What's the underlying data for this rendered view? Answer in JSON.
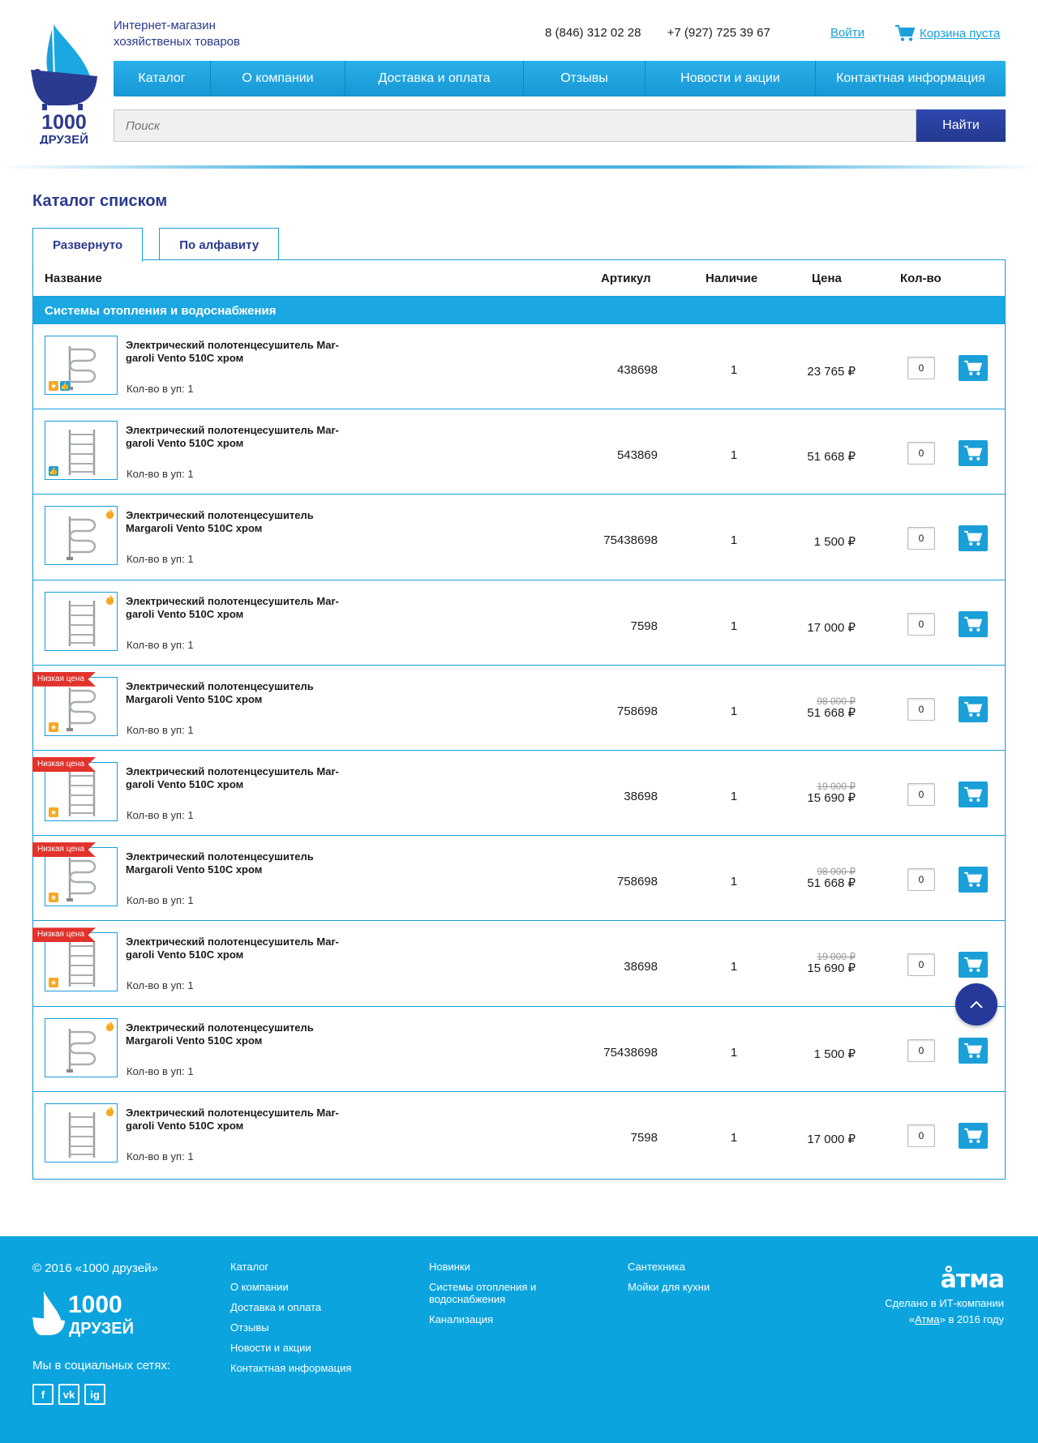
{
  "header": {
    "tagline_1": "Интернет-магазин",
    "tagline_2": "хозяйственых товаров",
    "logo_number": "1000",
    "logo_word": "ДРУЗЕЙ",
    "phone_1": "8 (846) 312 02 28",
    "phone_2": "+7 (927) 725 39 67",
    "login": "Войти",
    "cart": "Корзина пуста"
  },
  "nav": {
    "items": [
      {
        "label": "Каталог"
      },
      {
        "label": "О компании"
      },
      {
        "label": "Доставка и оплата"
      },
      {
        "label": "Отзывы"
      },
      {
        "label": "Новости и акции"
      },
      {
        "label": "Контактная информация"
      }
    ]
  },
  "search": {
    "placeholder": "Поиск",
    "button": "Найти"
  },
  "main": {
    "title": "Каталог списком",
    "tabs": [
      {
        "label": "Развернуто",
        "active": true
      },
      {
        "label": "По алфавиту",
        "active": false
      }
    ],
    "columns": {
      "name": "Название",
      "sku": "Артикул",
      "stock": "Наличие",
      "price": "Цена",
      "qty": "Кол-во"
    },
    "category": "Системы отопления и водоснабжения",
    "sale_label": "Низкая цена",
    "products": [
      {
        "name": "Электрический полотенцесушитель Mar-garoli Vento 510C хром",
        "pack": "Кол-во в уп: 1",
        "sku": "438698",
        "stock": "1",
        "price": "23 765 ₽",
        "old_price": "",
        "qty": "0",
        "badges": [
          "star",
          "like"
        ],
        "fire": false,
        "sale": false,
        "shape": "s-curve"
      },
      {
        "name": "Электрический полотенцесушитель Mar-garoli Vento 510C хром",
        "pack": "Кол-во в уп: 1",
        "sku": "543869",
        "stock": "1",
        "price": "51 668 ₽",
        "old_price": "",
        "qty": "0",
        "badges": [
          "like"
        ],
        "fire": false,
        "sale": false,
        "shape": "ladder"
      },
      {
        "name": "Электрический полотенцесушитель Margaroli Vento 510C хром",
        "pack": "Кол-во в уп: 1",
        "sku": "75438698",
        "stock": "1",
        "price": "1 500 ₽",
        "old_price": "",
        "qty": "0",
        "badges": [],
        "fire": true,
        "sale": false,
        "shape": "s-curve"
      },
      {
        "name": "Электрический полотенцесушитель Mar-garoli Vento 510C хром",
        "pack": "Кол-во в уп: 1",
        "sku": "7598",
        "stock": "1",
        "price": "17 000 ₽",
        "old_price": "",
        "qty": "0",
        "badges": [],
        "fire": true,
        "sale": false,
        "shape": "ladder"
      },
      {
        "name": "Электрический полотенцесушитель Margaroli Vento 510C хром",
        "pack": "Кол-во в уп: 1",
        "sku": "758698",
        "stock": "1",
        "price": "51 668 ₽",
        "old_price": "98 000 ₽",
        "qty": "0",
        "badges": [
          "star"
        ],
        "fire": false,
        "sale": true,
        "shape": "s-curve"
      },
      {
        "name": "Электрический полотенцесушитель Mar-garoli Vento 510C хром",
        "pack": "Кол-во в уп: 1",
        "sku": "38698",
        "stock": "1",
        "price": "15 690 ₽",
        "old_price": "19 000 ₽",
        "qty": "0",
        "badges": [
          "star"
        ],
        "fire": false,
        "sale": true,
        "shape": "ladder"
      },
      {
        "name": "Электрический полотенцесушитель Margaroli Vento 510C хром",
        "pack": "Кол-во в уп: 1",
        "sku": "758698",
        "stock": "1",
        "price": "51 668 ₽",
        "old_price": "98 000 ₽",
        "qty": "0",
        "badges": [
          "star"
        ],
        "fire": false,
        "sale": true,
        "shape": "s-curve"
      },
      {
        "name": "Электрический полотенцесушитель Mar-garoli Vento 510C хром",
        "pack": "Кол-во в уп: 1",
        "sku": "38698",
        "stock": "1",
        "price": "15 690 ₽",
        "old_price": "19 000 ₽",
        "qty": "0",
        "badges": [
          "star"
        ],
        "fire": false,
        "sale": true,
        "shape": "ladder"
      },
      {
        "name": "Электрический полотенцесушитель Margaroli Vento 510C хром",
        "pack": "Кол-во в уп: 1",
        "sku": "75438698",
        "stock": "1",
        "price": "1 500 ₽",
        "old_price": "",
        "qty": "0",
        "badges": [],
        "fire": true,
        "sale": false,
        "shape": "s-curve"
      },
      {
        "name": "Электрический полотенцесушитель Mar-garoli Vento 510C хром",
        "pack": "Кол-во в уп: 1",
        "sku": "7598",
        "stock": "1",
        "price": "17 000 ₽",
        "old_price": "",
        "qty": "0",
        "badges": [],
        "fire": true,
        "sale": false,
        "shape": "ladder"
      }
    ]
  },
  "footer": {
    "copyright": "© 2016 «1000 друзей»",
    "logo_number": "1000",
    "logo_word": "ДРУЗЕЙ",
    "social_title": "Мы в социальных сетях:",
    "socials": [
      "f",
      "vk",
      "ig"
    ],
    "col1": [
      "Каталог",
      "О компании",
      "Доставка и оплата",
      "Отзывы",
      "Новости и акции",
      "Контактная информация"
    ],
    "col2": [
      "Новинки",
      "Системы отопления и водоснабжения",
      "Канализация"
    ],
    "col3": [
      "Сантехника",
      "Мойки для кухни"
    ],
    "atma_logo": "åтма",
    "made_by_1": "Сделано в ИТ-компании",
    "made_by_2a": "«",
    "made_by_link": "Атма",
    "made_by_2b": "» в 2016 году"
  },
  "colors": {
    "accent": "#1a9fd9",
    "brand_dark": "#2a3a8f",
    "sale": "#e2322b",
    "star": "#f6a821"
  }
}
